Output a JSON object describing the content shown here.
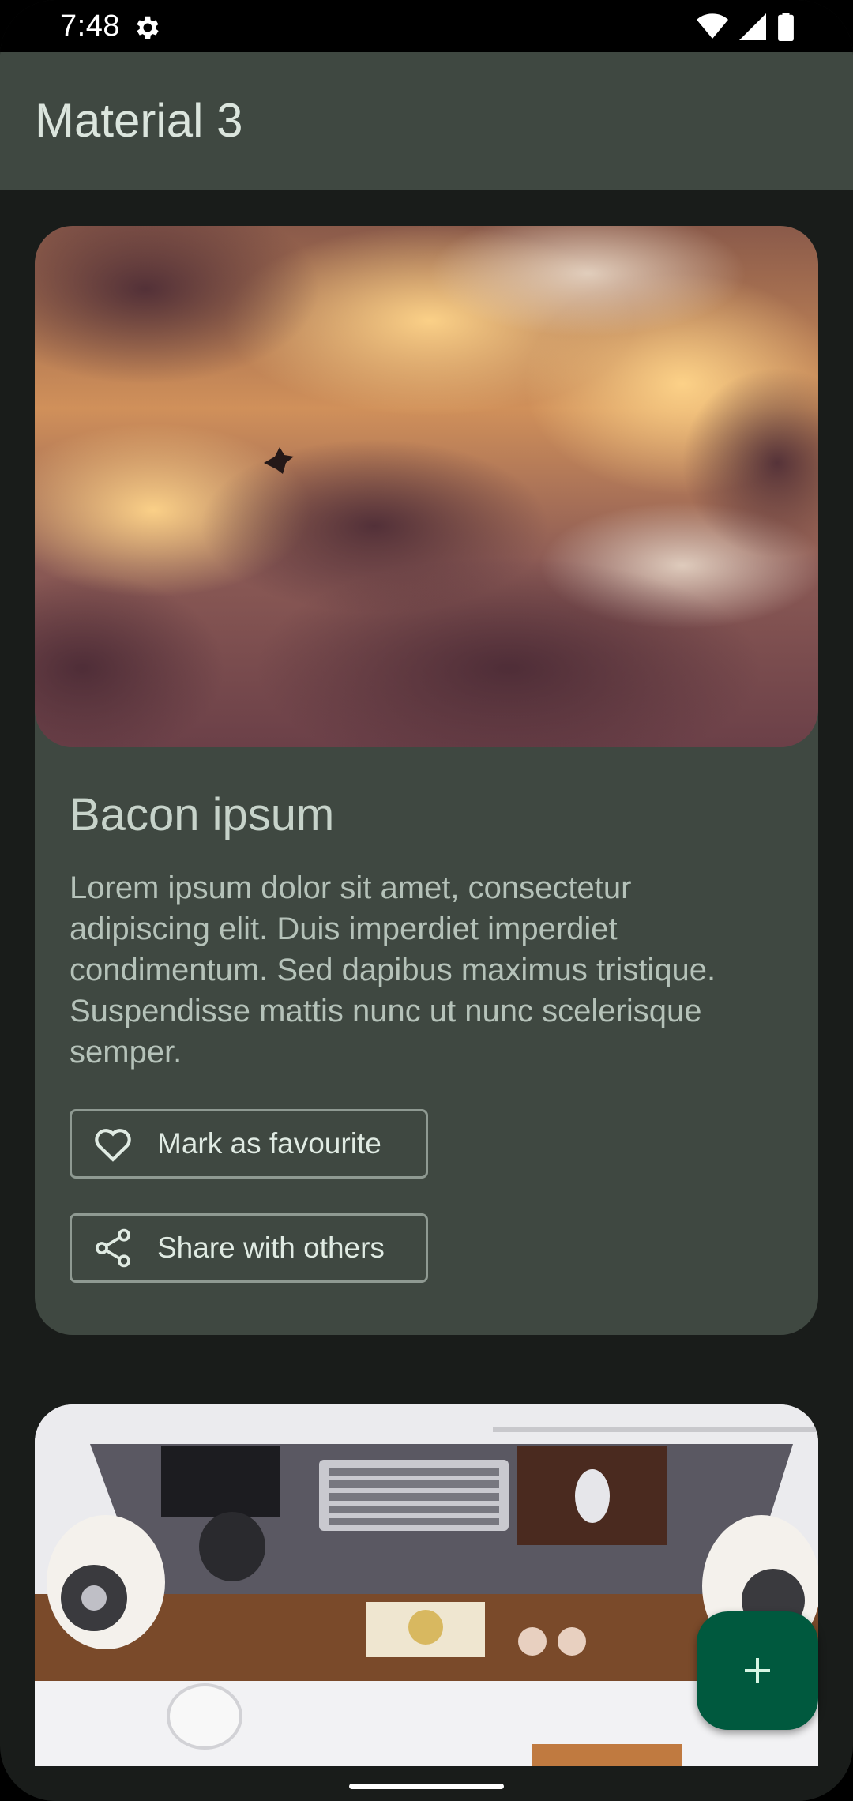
{
  "status_bar": {
    "time": "7:48",
    "icons": [
      "settings-gear-icon",
      "wifi-icon",
      "cellular-signal-icon",
      "battery-icon"
    ]
  },
  "app_bar": {
    "title": "Material 3"
  },
  "card": {
    "image": "sunset-clouds-with-bird-photo",
    "title": "Bacon ipsum",
    "body": "Lorem ipsum dolor sit amet, consectetur adipiscing elit. Duis imperdiet imperdiet condimentum. Sed dapibus maximus tristique. Suspendisse mattis nunc ut nunc scelerisque semper.",
    "buttons": [
      {
        "label": "Mark as favourite",
        "icon": "heart-outline-icon"
      },
      {
        "label": "Share with others",
        "icon": "share-icon"
      }
    ]
  },
  "card2": {
    "image": "desk-workspace-topdown-photo"
  },
  "fab": {
    "icon": "plus-icon"
  },
  "colors": {
    "background": "#191c1a",
    "surface": "#3f4841",
    "fab": "#00593e",
    "on_surface": "#dbe5dd"
  }
}
